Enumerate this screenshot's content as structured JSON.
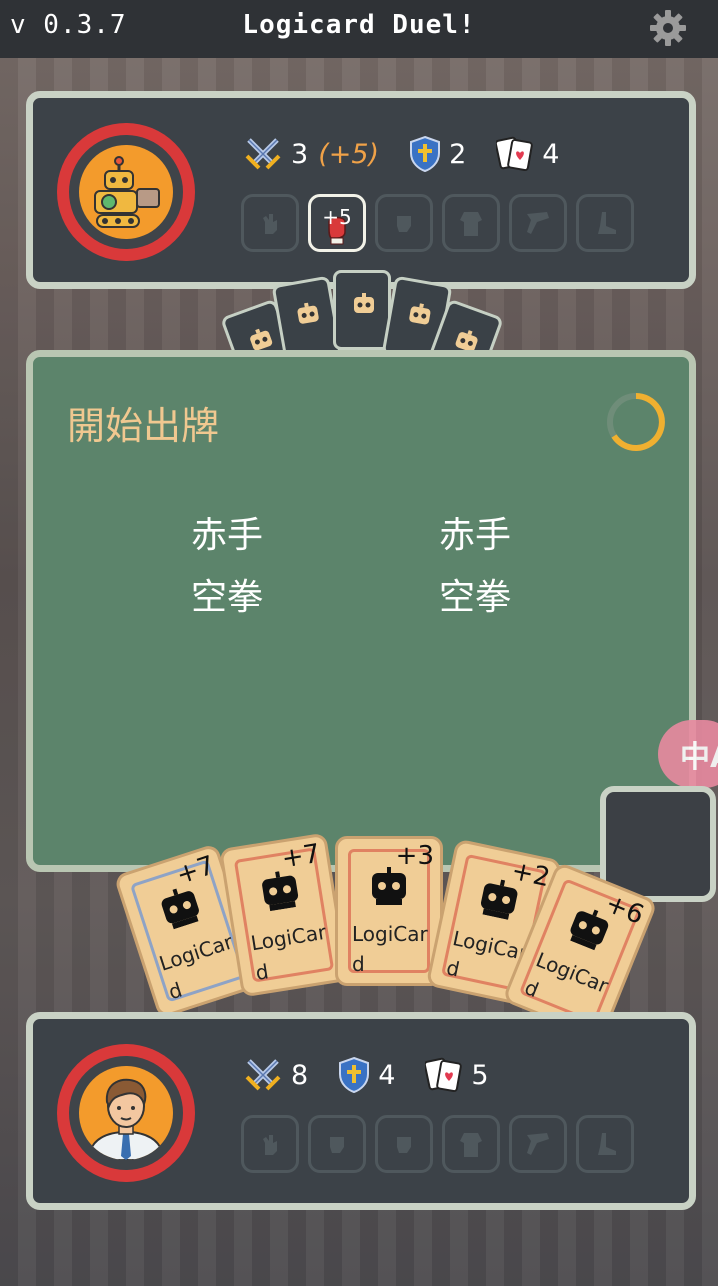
{
  "header": {
    "version": "v 0.3.7",
    "title": "Logicard Duel!",
    "settings_icon": "gear-icon"
  },
  "opponent": {
    "avatar_icon": "robot-avatar-icon",
    "attack": "3",
    "attack_bonus": "(+5)",
    "defense": "2",
    "cards": "4",
    "slots": [
      {
        "icon": "palm-icon",
        "value": ""
      },
      {
        "icon": "boxing-glove-icon",
        "value": "+5"
      },
      {
        "icon": "fist-icon",
        "value": ""
      },
      {
        "icon": "torso-icon",
        "value": ""
      },
      {
        "icon": "leg-icon",
        "value": ""
      },
      {
        "icon": "foot-icon",
        "value": ""
      }
    ]
  },
  "main": {
    "phase_label": "開始出牌",
    "left_move": [
      "赤手",
      "空拳"
    ],
    "right_move": [
      "赤手",
      "空拳"
    ]
  },
  "translate_label": "中A",
  "hand": [
    {
      "value": "+7",
      "name": "LogiCard"
    },
    {
      "value": "+7",
      "name": "LogiCard"
    },
    {
      "value": "+3",
      "name": "LogiCard"
    },
    {
      "value": "+2",
      "name": "LogiCard"
    },
    {
      "value": "+6",
      "name": "LogiCard"
    }
  ],
  "player": {
    "avatar_icon": "businessman-avatar-icon",
    "attack": "8",
    "defense": "4",
    "cards": "5",
    "slots": [
      {
        "icon": "palm-icon"
      },
      {
        "icon": "fist-icon"
      },
      {
        "icon": "fist-icon"
      },
      {
        "icon": "torso-icon"
      },
      {
        "icon": "leg-icon"
      },
      {
        "icon": "foot-icon"
      }
    ]
  },
  "colors": {
    "accent": "#f39b2c",
    "ring": "#d9393a",
    "panel": "#3c4248",
    "table": "#5c846b",
    "card": "#f0cd96"
  }
}
